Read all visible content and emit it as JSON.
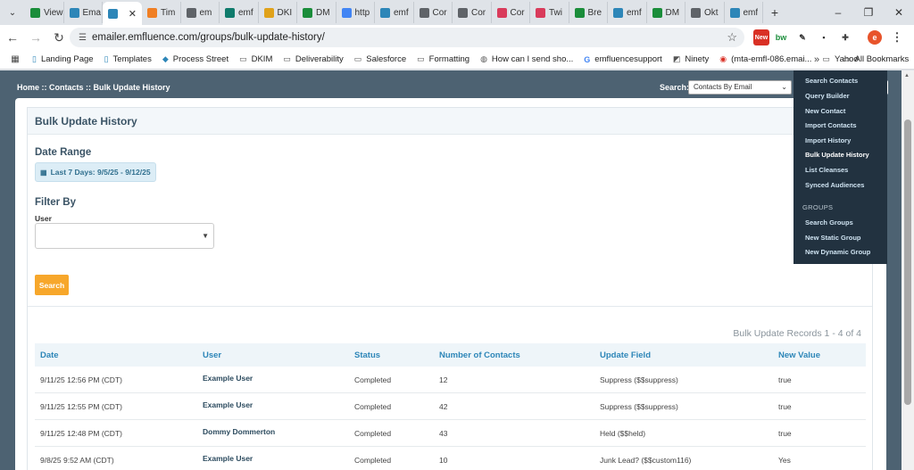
{
  "browser": {
    "tabs": [
      {
        "title": "View",
        "color": "#1a8d3a"
      },
      {
        "title": "Ema",
        "color": "#2d86b8"
      },
      {
        "title": "",
        "color": "#2d86b8",
        "active": true
      },
      {
        "title": "Tim",
        "color": "#f07f24"
      },
      {
        "title": "em",
        "color": "#5f6368"
      },
      {
        "title": "emf",
        "color": "#0f7b6c"
      },
      {
        "title": "DKI",
        "color": "#e0a21a"
      },
      {
        "title": "DM",
        "color": "#1a8d3a"
      },
      {
        "title": "http",
        "color": "#4285f4"
      },
      {
        "title": "emf",
        "color": "#2d86b8"
      },
      {
        "title": "Cor",
        "color": "#5f6368"
      },
      {
        "title": "Cor",
        "color": "#5f6368"
      },
      {
        "title": "Cor",
        "color": "#d93b5b"
      },
      {
        "title": "Twi",
        "color": "#d93b5b"
      },
      {
        "title": "Bre",
        "color": "#1a8d3a"
      },
      {
        "title": "emf",
        "color": "#2d86b8"
      },
      {
        "title": "DM",
        "color": "#1a8d3a"
      },
      {
        "title": "Okt",
        "color": "#5f6368"
      },
      {
        "title": "emf",
        "color": "#2d86b8"
      }
    ],
    "tab_close_glyph": "✕",
    "new_tab_glyph": "+",
    "tab_search_glyph": "⌄",
    "window_controls": [
      "–",
      "❐",
      "✕"
    ],
    "url": "emailer.emfluence.com/groups/bulk-update-history/",
    "profile_initial": "e",
    "ext_new_label": "New",
    "bookmarks": [
      {
        "label": "Landing Page",
        "icon": "doc-icon"
      },
      {
        "label": "Templates",
        "icon": "doc-icon"
      },
      {
        "label": "Process Street",
        "icon": "process-icon"
      },
      {
        "label": "DKIM",
        "icon": "folder-icon"
      },
      {
        "label": "Deliverability",
        "icon": "folder-icon"
      },
      {
        "label": "Salesforce",
        "icon": "folder-icon"
      },
      {
        "label": "Formatting",
        "icon": "folder-icon"
      },
      {
        "label": "How can I send sho...",
        "icon": "globe-icon"
      },
      {
        "label": "emfluencesupport",
        "icon": "google-icon"
      },
      {
        "label": "Ninety",
        "icon": "ninety-icon"
      },
      {
        "label": "(mta-emfl-086.emai...",
        "icon": "record-icon"
      },
      {
        "label": "Yahoo",
        "icon": "folder-icon"
      }
    ],
    "all_bookmarks": "All Bookmarks",
    "more_glyph": "»"
  },
  "header": {
    "breadcrumb": "Home :: Contacts :: Bulk Update History",
    "search_label": "Search:",
    "search_select_value": "Contacts By Email"
  },
  "main": {
    "title": "Bulk Update History",
    "date_range_heading": "Date Range",
    "date_range_value": "Last 7 Days: 9/5/25 - 9/12/25",
    "filter_heading": "Filter By",
    "user_label": "User",
    "user_select_value": "",
    "search_button": "Search",
    "records_count": "Bulk Update Records 1 - 4 of 4",
    "columns": [
      "Date",
      "User",
      "Status",
      "Number of Contacts",
      "Update Field",
      "New Value"
    ],
    "rows": [
      {
        "date": "9/11/25 12:56 PM (CDT)",
        "user": "Example User",
        "status": "Completed",
        "contacts": "12",
        "field": "Suppress ($$suppress)",
        "value": "true"
      },
      {
        "date": "9/11/25 12:55 PM (CDT)",
        "user": "Example User",
        "status": "Completed",
        "contacts": "42",
        "field": "Suppress ($$suppress)",
        "value": "true"
      },
      {
        "date": "9/11/25 12:48 PM (CDT)",
        "user": "Dommy Dommerton",
        "status": "Completed",
        "contacts": "43",
        "field": "Held ($$held)",
        "value": "true"
      },
      {
        "date": "9/8/25 9:52 AM (CDT)",
        "user": "Example User",
        "status": "Completed",
        "contacts": "10",
        "field": "Junk Lead? ($$custom116)",
        "value": "Yes"
      }
    ]
  },
  "menu": {
    "items": [
      {
        "label": "Search Contacts"
      },
      {
        "label": "Query Builder"
      },
      {
        "label": "New Contact"
      },
      {
        "label": "Import Contacts"
      },
      {
        "label": "Import History"
      },
      {
        "label": "Bulk Update History",
        "active": true
      },
      {
        "label": "List Cleanses"
      },
      {
        "label": "Synced Audiences"
      }
    ],
    "groups_heading": "GROUPS",
    "group_items": [
      {
        "label": "Search Groups"
      },
      {
        "label": "New Static Group"
      },
      {
        "label": "New Dynamic Group"
      }
    ]
  },
  "colors": {
    "page_bg": "#4d6272",
    "accent_blue": "#2d86b8",
    "button_orange": "#f7a72b",
    "menu_bg": "#223240"
  }
}
